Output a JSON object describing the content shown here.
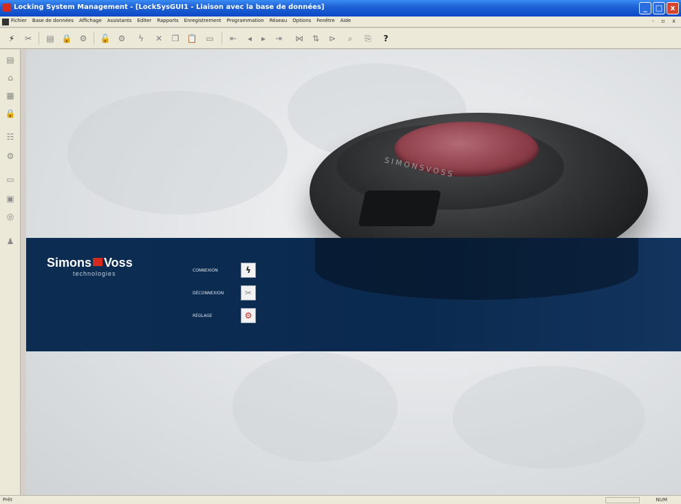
{
  "window": {
    "title": "Locking System Management - [LockSysGUI1 - Liaison avec la base de données]",
    "controls": [
      "_",
      "□",
      "x"
    ]
  },
  "menu": {
    "items": [
      "Fichier",
      "Base de données",
      "Affichage",
      "Assistants",
      "Editer",
      "Rapports",
      "Enregistrement",
      "Programmation",
      "Réseau",
      "Options",
      "Fenêtre",
      "Aide"
    ],
    "mdi_controls": "- ▫ x"
  },
  "toolbar": {
    "icons": [
      "connect-icon",
      "disconnect-icon",
      "list-icon",
      "lock-icon",
      "gear-icon",
      "lock-add-icon",
      "gear-add-icon",
      "lightning-icon",
      "delete-icon",
      "copy-icon",
      "paste-icon",
      "print-icon",
      "first-icon",
      "prev-icon",
      "next-icon",
      "last-icon",
      "pick-icon",
      "sort-icon",
      "filter-icon",
      "search-icon",
      "export-icon",
      "help-icon"
    ]
  },
  "lefttoolbar": {
    "icons": [
      "list-icon",
      "home-icon",
      "building-icon",
      "lock-icon",
      "people-icon",
      "gear-icon",
      "card-icon",
      "id-icon",
      "network-icon",
      "person-icon"
    ]
  },
  "brand": {
    "name_left": "Simons",
    "name_right": "Voss",
    "tagline": "technologies",
    "accent": "#d62a1e",
    "band_color": "#0b2a4f"
  },
  "actions": [
    {
      "label": "CONNEXION",
      "icon": "connect-icon"
    },
    {
      "label": "DÉCONNEXION",
      "icon": "disconnect-icon"
    },
    {
      "label": "RÉGLAGE",
      "icon": "settings-icon"
    }
  ],
  "product": {
    "engraving": "SIMONSVOSS"
  },
  "status": {
    "left": "Prêt",
    "num": "NUM"
  }
}
